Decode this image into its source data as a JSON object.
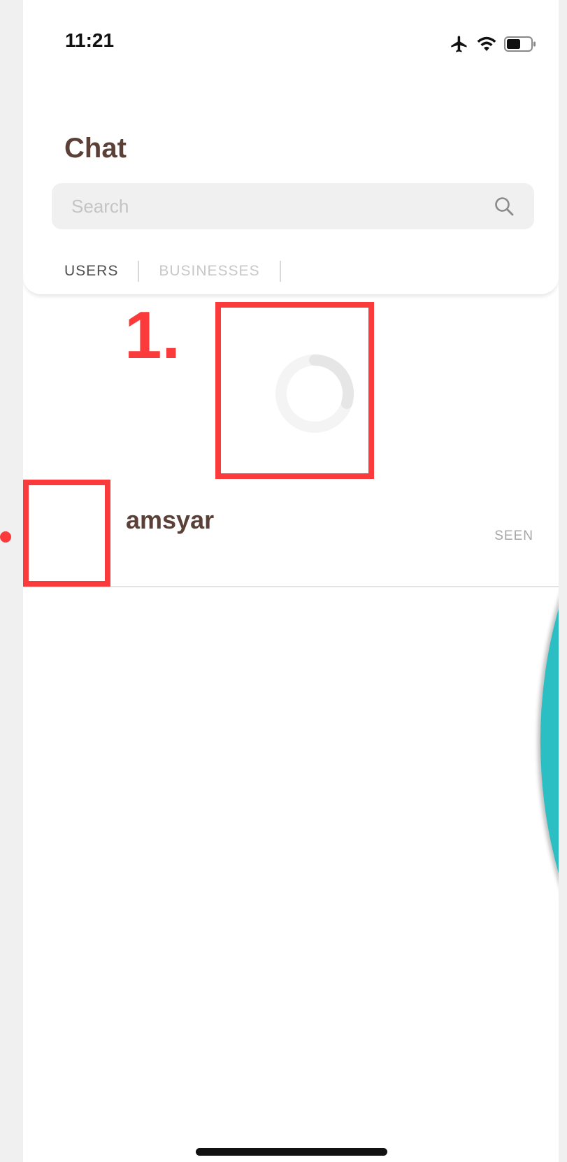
{
  "status_bar": {
    "time": "11:21",
    "icons": [
      "airplane-mode-icon",
      "wifi-icon",
      "battery-icon"
    ]
  },
  "header": {
    "title": "Chat"
  },
  "search": {
    "placeholder": "Search",
    "value": "",
    "icon": "search-icon"
  },
  "tabs": [
    {
      "label": "USERS",
      "active": true
    },
    {
      "label": "BUSINESSES",
      "active": false
    }
  ],
  "loading_indicator": {
    "icon": "loading-spinner-icon"
  },
  "chats": [
    {
      "name": "amsyar",
      "status": "SEEN"
    }
  ],
  "annotations": [
    {
      "label": "1."
    }
  ],
  "colors": {
    "title": "#5b4038",
    "annotation": "#fb3b3b",
    "accent_teal": "#2bbfc4",
    "search_bg": "#f0f0f0"
  }
}
